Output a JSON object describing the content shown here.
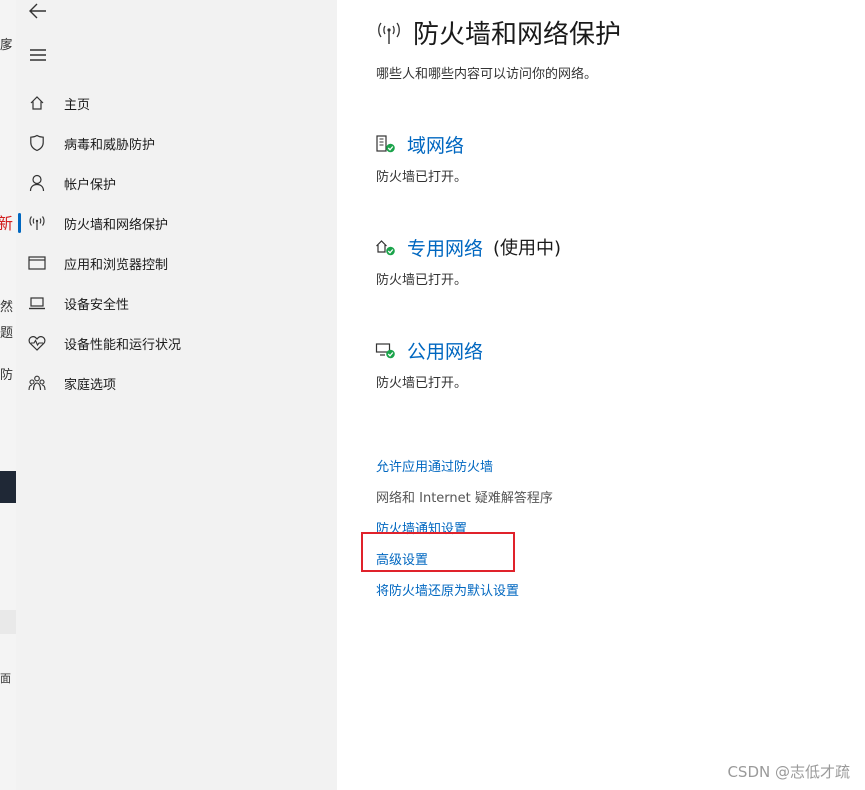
{
  "background_window": {
    "fragments": [
      "扅",
      "新",
      "然",
      "题",
      "防",
      "面"
    ]
  },
  "sidebar": {
    "items": [
      {
        "label": "主页",
        "icon": "home-icon"
      },
      {
        "label": "病毒和威胁防护",
        "icon": "shield-icon"
      },
      {
        "label": "帐户保护",
        "icon": "person-icon"
      },
      {
        "label": "防火墙和网络保护",
        "icon": "antenna-icon"
      },
      {
        "label": "应用和浏览器控制",
        "icon": "browser-window-icon"
      },
      {
        "label": "设备安全性",
        "icon": "laptop-icon"
      },
      {
        "label": "设备性能和运行状况",
        "icon": "heart-pulse-icon"
      },
      {
        "label": "家庭选项",
        "icon": "family-icon"
      }
    ],
    "active_index": 3
  },
  "main": {
    "title": "防火墙和网络保护",
    "subtitle": "哪些人和哪些内容可以访问你的网络。",
    "networks": [
      {
        "name": "域网络",
        "status": "防火墙已打开。",
        "active_tag": "",
        "icon": "domain-network-icon"
      },
      {
        "name": "专用网络",
        "status": "防火墙已打开。",
        "active_tag": "(使用中)",
        "icon": "private-network-icon"
      },
      {
        "name": "公用网络",
        "status": "防火墙已打开。",
        "active_tag": "",
        "icon": "public-network-icon"
      }
    ],
    "links": {
      "allow_app": "允许应用通过防火墙",
      "troubleshooter": "网络和 Internet 疑难解答程序",
      "notification_settings": "防火墙通知设置",
      "advanced_settings": "高级设置",
      "restore_defaults": "将防火墙还原为默认设置"
    }
  },
  "watermark": "CSDN @志低才疏",
  "colors": {
    "accent": "#0067c0",
    "highlight_box": "#e0222b",
    "sidebar_bg": "#f2f2f2",
    "status_ok": "#1aa34a"
  }
}
